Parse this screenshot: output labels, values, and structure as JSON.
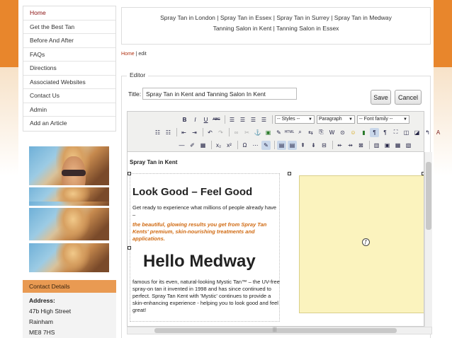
{
  "nav": {
    "items": [
      {
        "label": "Home"
      },
      {
        "label": "Get the Best Tan"
      },
      {
        "label": "Before And After"
      },
      {
        "label": "FAQs"
      },
      {
        "label": "Directions"
      },
      {
        "label": "Associated Websites"
      },
      {
        "label": "Contact Us"
      },
      {
        "label": "Admin"
      },
      {
        "label": "Add an Article"
      }
    ]
  },
  "contact": {
    "heading": "Contact Details",
    "address_label": "Address:",
    "address_lines": [
      "47b High Street",
      "Rainham",
      "ME8 7HS"
    ]
  },
  "top_links": {
    "line1": "Spray Tan in London | Spray Tan in Essex | Spray Tan in Surrey | Spray Tan in Medway",
    "line2": "Tanning Salon in Kent | Tanning Salon in Essex"
  },
  "breadcrumb": {
    "home": "Home",
    "sep": " | ",
    "current": "edit"
  },
  "editor": {
    "legend": "Editor",
    "title_label": "Title:",
    "title_value": "Spray Tan in Kent and Tanning Salon In Kent",
    "save_label": "Save",
    "cancel_label": "Cancel"
  },
  "toolbar": {
    "styles_select": "-- Styles --",
    "format_select": "Paragraph",
    "font_select": "-- Font family --"
  },
  "content": {
    "heading": "Spray Tan in Kent",
    "h1": "Look Good – Feel Good",
    "p1": "Get ready to experience what millions of people already have –",
    "orange": "the beautiful, glowing results you get from Spray Tan Kents' premium, skin-nourishing treatments and applications.",
    "big": "Hello Medway",
    "p2": "famous for its even, natural-looking Mystic Tan™ – the UV-free spray-on tan it invented in 1998 and has since continued to perfect. Spray Tan Kent with 'Mystic' continues to provide a skin-enhancing experience - helping you to look good and feel great!"
  },
  "colors": {
    "accent_orange": "#e8862c",
    "nav_active": "#8a1010",
    "contact_header": "#e99a52",
    "placeholder_yellow": "#fbf3be"
  }
}
